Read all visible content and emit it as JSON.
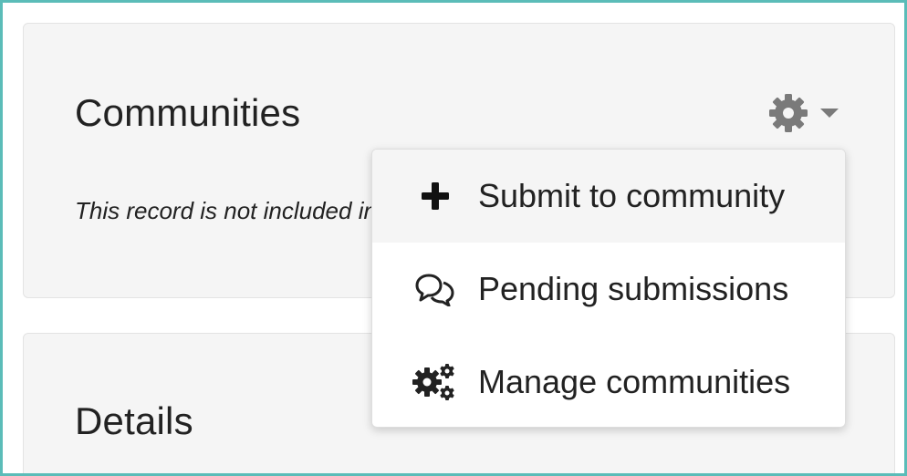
{
  "communities": {
    "title": "Communities",
    "note": "This record is not included in any communities yet.",
    "settings_icon": "gear-icon",
    "dropdown_icon": "caret-down-icon"
  },
  "menu": {
    "items": [
      {
        "label": "Submit to community",
        "icon": "plus-icon",
        "active": true
      },
      {
        "label": "Pending submissions",
        "icon": "comments-icon",
        "active": false
      },
      {
        "label": "Manage communities",
        "icon": "cogs-icon",
        "active": false
      }
    ]
  },
  "details": {
    "title": "Details"
  },
  "colors": {
    "frame_border": "#5bbcb8",
    "card_background": "#f5f5f5",
    "icon_gray": "#7a7a7a",
    "text": "#222222"
  }
}
